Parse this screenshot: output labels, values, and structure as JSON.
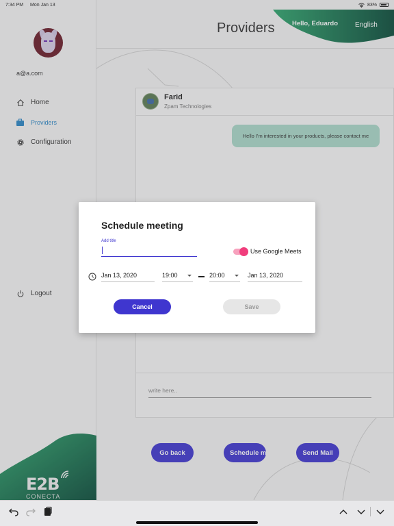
{
  "status_bar": {
    "time": "7:34 PM",
    "date": "Mon Jan 13",
    "battery": "83%"
  },
  "sidebar": {
    "email": "a@a.com",
    "items": [
      {
        "label": "Home",
        "icon": "home-icon"
      },
      {
        "label": "Providers",
        "icon": "briefcase-icon",
        "active": true
      },
      {
        "label": "Configuration",
        "icon": "gear-icon"
      }
    ],
    "logout": "Logout",
    "logo": "E2B",
    "logo_sub": "CONECTA"
  },
  "header": {
    "title": "Providers",
    "greeting": "Hello, Eduardo",
    "language": "English"
  },
  "chat": {
    "contact_name": "Farid",
    "contact_company": "Zpam Technologies",
    "message": "Hello I'm interested in your products, please contact me",
    "input_placeholder": "write here.."
  },
  "actions": {
    "go_back": "Go back",
    "schedule": "Schedule meeting",
    "send_mail": "Send Mail"
  },
  "dialog": {
    "title": "Schedule meeting",
    "title_field_label": "Add title",
    "title_value": "",
    "google_meets_label": "Use Google Meets",
    "google_meets_enabled": true,
    "start_date": "Jan 13, 2020",
    "start_time": "19:00",
    "end_time": "20:00",
    "end_date": "Jan 13, 2020",
    "cancel_label": "Cancel",
    "save_label": "Save"
  },
  "colors": {
    "primary": "#3f36cf",
    "accent_green": "#1e8a5c",
    "toggle": "#f03d7c",
    "bubble": "#a9d8c8"
  }
}
